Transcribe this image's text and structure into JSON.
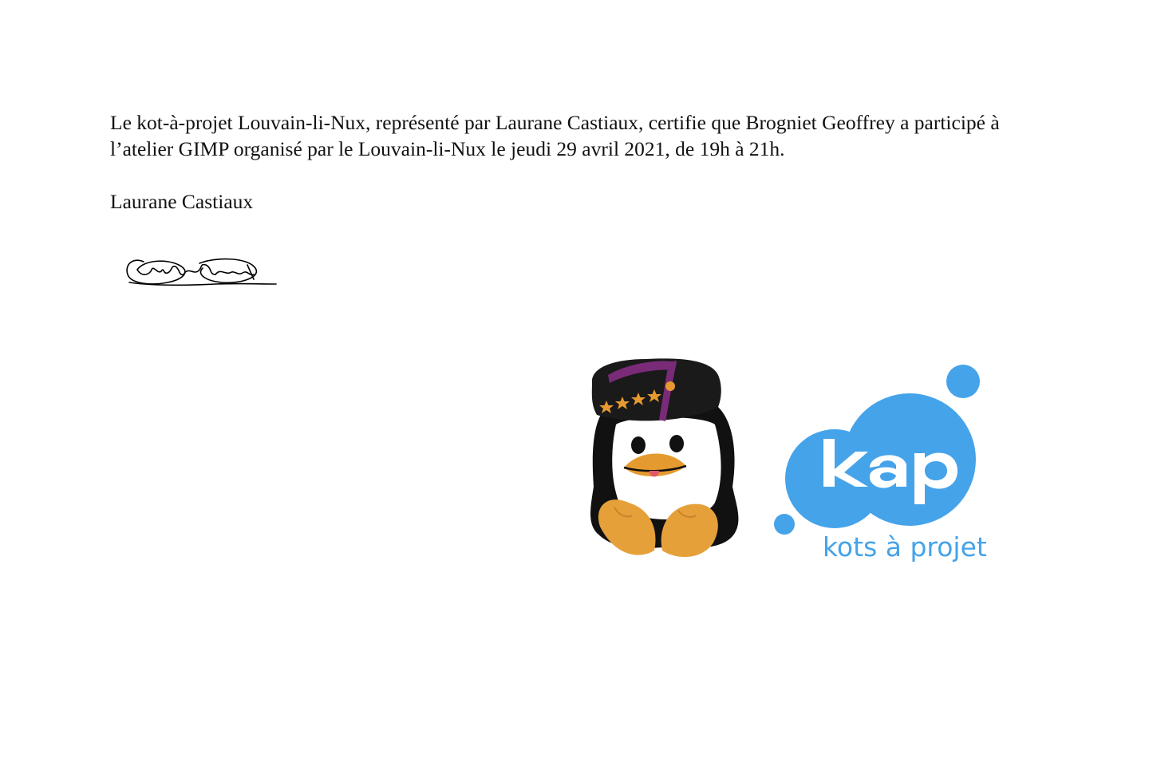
{
  "document": {
    "body_text": "Le kot-à-projet Louvain-li-Nux, représenté par Laurane Castiaux, certifie que Brogniet Geoffrey a participé à l’atelier GIMP organisé par le Louvain-li-Nux le jeudi 29 avril 2021, de 19h à 21h.",
    "signatory": "Laurane Castiaux"
  },
  "signature": {
    "text": "Castiaux",
    "icon": "handwritten-signature"
  },
  "logos": {
    "tux": {
      "icon": "tux-penguin-student-cap-icon",
      "cap_color": "#1a1a1a",
      "ribbon_color": "#7a2b78",
      "star_color": "#e59a2f",
      "feet_color": "#e5a03a"
    },
    "kap": {
      "icon": "kap-bubbles-logo",
      "wordmark": "kap",
      "tagline": "kots à projet",
      "color": "#45a3ea"
    }
  }
}
